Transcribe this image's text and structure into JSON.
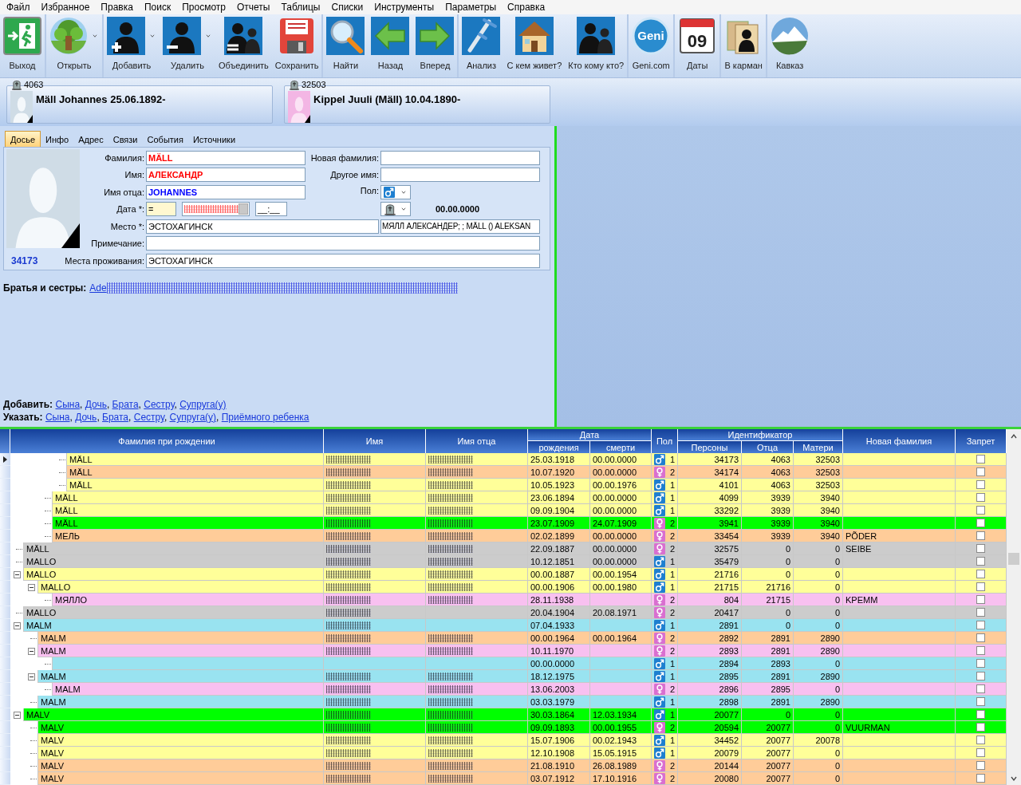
{
  "menu": [
    "Файл",
    "Избранное",
    "Правка",
    "Поиск",
    "Просмотр",
    "Отчеты",
    "Таблицы",
    "Списки",
    "Инструменты",
    "Параметры",
    "Справка"
  ],
  "toolbar": [
    {
      "label": "Выход",
      "kind": "exit",
      "dropdown": false,
      "separator": false
    },
    {
      "label": "Открыть",
      "kind": "tree",
      "dropdown": true,
      "separator": true
    },
    {
      "label": "Добавить",
      "kind": "add",
      "dropdown": true,
      "separator": true
    },
    {
      "label": "Удалить",
      "kind": "remove",
      "dropdown": true,
      "separator": false
    },
    {
      "label": "Объединить",
      "kind": "merge",
      "dropdown": false,
      "separator": false
    },
    {
      "label": "Сохранить",
      "kind": "save",
      "dropdown": false,
      "separator": false
    },
    {
      "label": "Найти",
      "kind": "search",
      "dropdown": false,
      "separator": true
    },
    {
      "label": "Назад",
      "kind": "back",
      "dropdown": false,
      "separator": false
    },
    {
      "label": "Вперед",
      "kind": "forward",
      "dropdown": false,
      "separator": false
    },
    {
      "label": "Анализ",
      "kind": "crutch",
      "dropdown": false,
      "separator": true
    },
    {
      "label": "С кем живет?",
      "kind": "house",
      "dropdown": false,
      "separator": false
    },
    {
      "label": "Кто кому кто?",
      "kind": "question",
      "dropdown": false,
      "separator": false
    },
    {
      "label": "Geni.com",
      "kind": "geni",
      "logo_text": "Geni",
      "dropdown": false,
      "separator": true
    },
    {
      "label": "Даты",
      "kind": "calendar",
      "logo_text": "09",
      "dropdown": false,
      "separator": true
    },
    {
      "label": "В карман",
      "kind": "documents",
      "dropdown": false,
      "separator": true
    },
    {
      "label": "Кавказ",
      "kind": "mountain",
      "dropdown": false,
      "separator": true
    }
  ],
  "parents": [
    {
      "id": "4063",
      "name": "Mäll Johannes 25.06.1892-",
      "kind": "male"
    },
    {
      "id": "32503",
      "name": "Kippel Juuli (Mäll) 10.04.1890-",
      "kind": "female"
    }
  ],
  "tabs": [
    {
      "label": "Досье",
      "selected": true
    },
    {
      "label": "Инфо",
      "selected": false
    },
    {
      "label": "Адрес",
      "selected": false
    },
    {
      "label": "Связи",
      "selected": false
    },
    {
      "label": "События",
      "selected": false
    },
    {
      "label": "Источники",
      "selected": false
    }
  ],
  "dossier": {
    "surname": {
      "label": "Фамилия:",
      "value": "MÄLL",
      "color": "#ff0000"
    },
    "given_name": {
      "label": "Имя:",
      "value": "АЛЕКСАНДР",
      "color": "#ff0000"
    },
    "patronymic": {
      "label": "Имя отца:",
      "value": "JOHANNES",
      "color": "#0000ff"
    },
    "new_surname": {
      "label": "Новая фамилия:"
    },
    "other_name": {
      "label": "Другое имя:"
    },
    "sex": {
      "label": "Пол:",
      "kind": "male"
    },
    "date": {
      "label": "Дата *:",
      "qualifier": "=",
      "value_obscured": true,
      "time": "__:__"
    },
    "death_date": "00.00.0000",
    "place": {
      "label": "Место *:",
      "value": "ЭСТОХАГИНСК"
    },
    "place_full": "МЯЛЛ АЛЕКСАНДЕР; ; MÄLL () ALEKSAN",
    "note": {
      "label": "Примечание:"
    },
    "residence": {
      "label": "Места проживания:",
      "value": "ЭСТОХАГИНСК"
    },
    "person_id": "34173"
  },
  "siblings": {
    "label": "Братья и сестры:",
    "links": [
      "Ade"
    ],
    "obscured": true
  },
  "add_line": {
    "label": "Добавить:",
    "separator": ", ",
    "links": [
      "Сына",
      "Дочь",
      "Брата",
      "Сестру",
      "Супруга(у)"
    ]
  },
  "assign_line": {
    "label": "Указать:",
    "separator": ", ",
    "links": [
      "Сына",
      "Дочь",
      "Брата",
      "Сестру",
      "Супруга(у)",
      "Приёмного ребенка"
    ]
  },
  "table": {
    "columns": [
      {
        "label": "Фамилия при рождении"
      },
      {
        "label": "Имя"
      },
      {
        "label": "Имя отца"
      },
      {
        "label": "Дата",
        "children": [
          {
            "label": "рождения"
          },
          {
            "label": "смерти"
          }
        ]
      },
      {
        "label": "Пол"
      },
      {
        "label": "Идентификатор",
        "children": [
          {
            "label": "Персоны"
          },
          {
            "label": "Отца"
          },
          {
            "label": "Матери"
          }
        ]
      },
      {
        "label": "Новая фамилия"
      },
      {
        "label": "Запрет"
      }
    ],
    "rows": [
      {
        "children": [
          {
            "children": [
              {
                "children": [
                  {
                    "surname": "MÄLL",
                    "name_obscured": true,
                    "patronymic_obscured": true,
                    "born": "25.03.1918",
                    "died": "00.00.0000",
                    "kind": "male",
                    "sex": "1",
                    "person_id": "34173",
                    "father_id": "4063",
                    "mother_id": "32503",
                    "banned": false,
                    "color": "#ffff99",
                    "selected": true
                  },
                  {
                    "surname": "MÄLL",
                    "name_obscured": true,
                    "patronymic_obscured": true,
                    "born": "10.07.1920",
                    "died": "00.00.0000",
                    "kind": "female",
                    "sex": "2",
                    "person_id": "34174",
                    "father_id": "4063",
                    "mother_id": "32503",
                    "banned": false,
                    "color": "#ffcc99",
                    "selected": false
                  },
                  {
                    "surname": "MÄLL",
                    "name_obscured": true,
                    "patronymic_obscured": true,
                    "born": "10.05.1923",
                    "died": "00.00.1976",
                    "kind": "male",
                    "sex": "1",
                    "person_id": "4101",
                    "father_id": "4063",
                    "mother_id": "32503",
                    "banned": false,
                    "color": "#ffff99",
                    "selected": false
                  }
                ]
              },
              {
                "surname": "MÄLL",
                "name_obscured": true,
                "patronymic_obscured": true,
                "born": "23.06.1894",
                "died": "00.00.0000",
                "kind": "male",
                "sex": "1",
                "person_id": "4099",
                "father_id": "3939",
                "mother_id": "3940",
                "banned": false,
                "color": "#ffff99",
                "selected": false
              },
              {
                "surname": "MÄLL",
                "name_obscured": true,
                "patronymic_obscured": true,
                "born": "09.09.1904",
                "died": "00.00.0000",
                "kind": "male",
                "sex": "1",
                "person_id": "33292",
                "father_id": "3939",
                "mother_id": "3940",
                "banned": false,
                "color": "#ffff99",
                "selected": false
              },
              {
                "surname": "MÄLL",
                "name_obscured": true,
                "patronymic_obscured": true,
                "born": "23.07.1909",
                "died": "24.07.1909",
                "kind": "female",
                "sex": "2",
                "person_id": "3941",
                "father_id": "3939",
                "mother_id": "3940",
                "banned": false,
                "color": "#00ff00",
                "selected": false
              },
              {
                "surname": "МЕЛЬ",
                "name_obscured": true,
                "patronymic_obscured": true,
                "born": "02.02.1899",
                "died": "00.00.0000",
                "kind": "female",
                "sex": "2",
                "person_id": "33454",
                "father_id": "3939",
                "mother_id": "3940",
                "new_surname": "PÕDER",
                "banned": false,
                "color": "#ffcc99",
                "selected": false
              }
            ]
          }
        ]
      },
      {
        "surname": "MÄLL",
        "name_obscured": true,
        "patronymic_obscured": true,
        "born": "22.09.1887",
        "died": "00.00.0000",
        "kind": "female",
        "sex": "2",
        "person_id": "32575",
        "father_id": "0",
        "mother_id": "0",
        "new_surname": "SEIBE",
        "banned": false,
        "color": "#cccccc",
        "selected": false
      },
      {
        "surname": "MALLO",
        "name_obscured": true,
        "patronymic_obscured": true,
        "born": "10.12.1851",
        "died": "00.00.0000",
        "kind": "male",
        "sex": "1",
        "person_id": "35479",
        "father_id": "0",
        "mother_id": "0",
        "banned": false,
        "color": "#cccccc",
        "selected": false
      },
      {
        "surname": "MALLO",
        "name_obscured": true,
        "patronymic_obscured": true,
        "born": "00.00.1887",
        "died": "00.00.1954",
        "kind": "male",
        "sex": "1",
        "person_id": "21716",
        "father_id": "0",
        "mother_id": "0",
        "banned": false,
        "color": "#ffff99",
        "selected": false,
        "expanded": true,
        "children": [
          {
            "surname": "MALLO",
            "name_obscured": true,
            "patronymic_obscured": true,
            "born": "00.00.1906",
            "died": "00.00.1980",
            "kind": "male",
            "sex": "1",
            "person_id": "21715",
            "father_id": "21716",
            "mother_id": "0",
            "banned": false,
            "color": "#ffff99",
            "selected": false,
            "expanded": true,
            "children": [
              {
                "surname": "МЯЛЛО",
                "name_obscured": true,
                "patronymic_obscured": true,
                "born": "28.11.1938",
                "kind": "female",
                "sex": "2",
                "person_id": "804",
                "father_id": "21715",
                "mother_id": "0",
                "new_surname": "KPEMM",
                "banned": false,
                "color": "#f8c0f0",
                "selected": false
              }
            ]
          }
        ]
      },
      {
        "surname": "MALLO",
        "name_obscured": true,
        "patronymic_obscured": false,
        "born": "20.04.1904",
        "died": "20.08.1971",
        "kind": "female",
        "sex": "2",
        "person_id": "20417",
        "father_id": "0",
        "mother_id": "0",
        "banned": false,
        "color": "#cccccc",
        "selected": false
      },
      {
        "surname": "MALM",
        "name_obscured": true,
        "patronymic_obscured": false,
        "born": "07.04.1933",
        "kind": "male",
        "sex": "1",
        "person_id": "2891",
        "father_id": "0",
        "mother_id": "0",
        "banned": false,
        "color": "#99e3f0",
        "selected": false,
        "expanded": true,
        "children": [
          {
            "surname": "MALM",
            "name_obscured": true,
            "patronymic_obscured": true,
            "born": "00.00.1964",
            "died": "00.00.1964",
            "kind": "female",
            "sex": "2",
            "person_id": "2892",
            "father_id": "2891",
            "mother_id": "2890",
            "banned": false,
            "color": "#ffcc99",
            "selected": false
          },
          {
            "surname": "MALM",
            "name_obscured": true,
            "patronymic_obscured": true,
            "born": "10.11.1970",
            "kind": "female",
            "sex": "2",
            "person_id": "2893",
            "father_id": "2891",
            "mother_id": "2890",
            "banned": false,
            "color": "#f8c0f0",
            "selected": false,
            "expanded": true,
            "children": [
              {
                "name_obscured": false,
                "patronymic_obscured": false,
                "born": "00.00.0000",
                "kind": "male",
                "sex": "1",
                "person_id": "2894",
                "father_id": "2893",
                "mother_id": "0",
                "banned": false,
                "color": "#99e3f0",
                "selected": false
              }
            ]
          },
          {
            "surname": "MALM",
            "name_obscured": true,
            "patronymic_obscured": true,
            "born": "18.12.1975",
            "kind": "male",
            "sex": "1",
            "person_id": "2895",
            "father_id": "2891",
            "mother_id": "2890",
            "banned": false,
            "color": "#99e3f0",
            "selected": false,
            "expanded": true,
            "children": [
              {
                "surname": "MALM",
                "name_obscured": true,
                "patronymic_obscured": true,
                "born": "13.06.2003",
                "kind": "female",
                "sex": "2",
                "person_id": "2896",
                "father_id": "2895",
                "mother_id": "0",
                "banned": false,
                "color": "#f8c0f0",
                "selected": false
              }
            ]
          },
          {
            "surname": "MALM",
            "name_obscured": true,
            "patronymic_obscured": true,
            "born": "03.03.1979",
            "kind": "male",
            "sex": "1",
            "person_id": "2898",
            "father_id": "2891",
            "mother_id": "2890",
            "banned": false,
            "color": "#99e3f0",
            "selected": false
          }
        ]
      },
      {
        "surname": "MALV",
        "name_obscured": true,
        "patronymic_obscured": true,
        "born": "30.03.1864",
        "died": "12.03.1934",
        "kind": "male",
        "sex": "1",
        "person_id": "20077",
        "father_id": "0",
        "mother_id": "0",
        "banned": false,
        "color": "#00ff00",
        "selected": false,
        "expanded": true,
        "children": [
          {
            "surname": "MALV",
            "name_obscured": true,
            "patronymic_obscured": true,
            "born": "09.09.1893",
            "died": "00.00.1955",
            "kind": "female",
            "sex": "2",
            "person_id": "20594",
            "father_id": "20077",
            "mother_id": "0",
            "new_surname": "VUURMAN",
            "banned": false,
            "color": "#00ff00",
            "selected": false
          },
          {
            "surname": "MALV",
            "name_obscured": true,
            "patronymic_obscured": true,
            "born": "15.07.1906",
            "died": "00.02.1943",
            "kind": "male",
            "sex": "1",
            "person_id": "34452",
            "father_id": "20077",
            "mother_id": "20078",
            "banned": false,
            "color": "#ffff99",
            "selected": false
          },
          {
            "surname": "MALV",
            "name_obscured": true,
            "patronymic_obscured": true,
            "born": "12.10.1908",
            "died": "15.05.1915",
            "kind": "male",
            "sex": "1",
            "person_id": "20079",
            "father_id": "20077",
            "mother_id": "0",
            "banned": false,
            "color": "#ffff99",
            "selected": false
          },
          {
            "surname": "MALV",
            "name_obscured": true,
            "patronymic_obscured": true,
            "born": "21.08.1910",
            "died": "26.08.1989",
            "kind": "female",
            "sex": "2",
            "person_id": "20144",
            "father_id": "20077",
            "mother_id": "0",
            "banned": false,
            "color": "#ffcc99",
            "selected": false
          },
          {
            "surname": "MALV",
            "name_obscured": true,
            "patronymic_obscured": true,
            "born": "03.07.1912",
            "died": "17.10.1916",
            "kind": "female",
            "sex": "2",
            "person_id": "20080",
            "father_id": "20077",
            "mother_id": "0",
            "banned": false,
            "color": "#ffcc99",
            "selected": false
          }
        ]
      }
    ]
  }
}
